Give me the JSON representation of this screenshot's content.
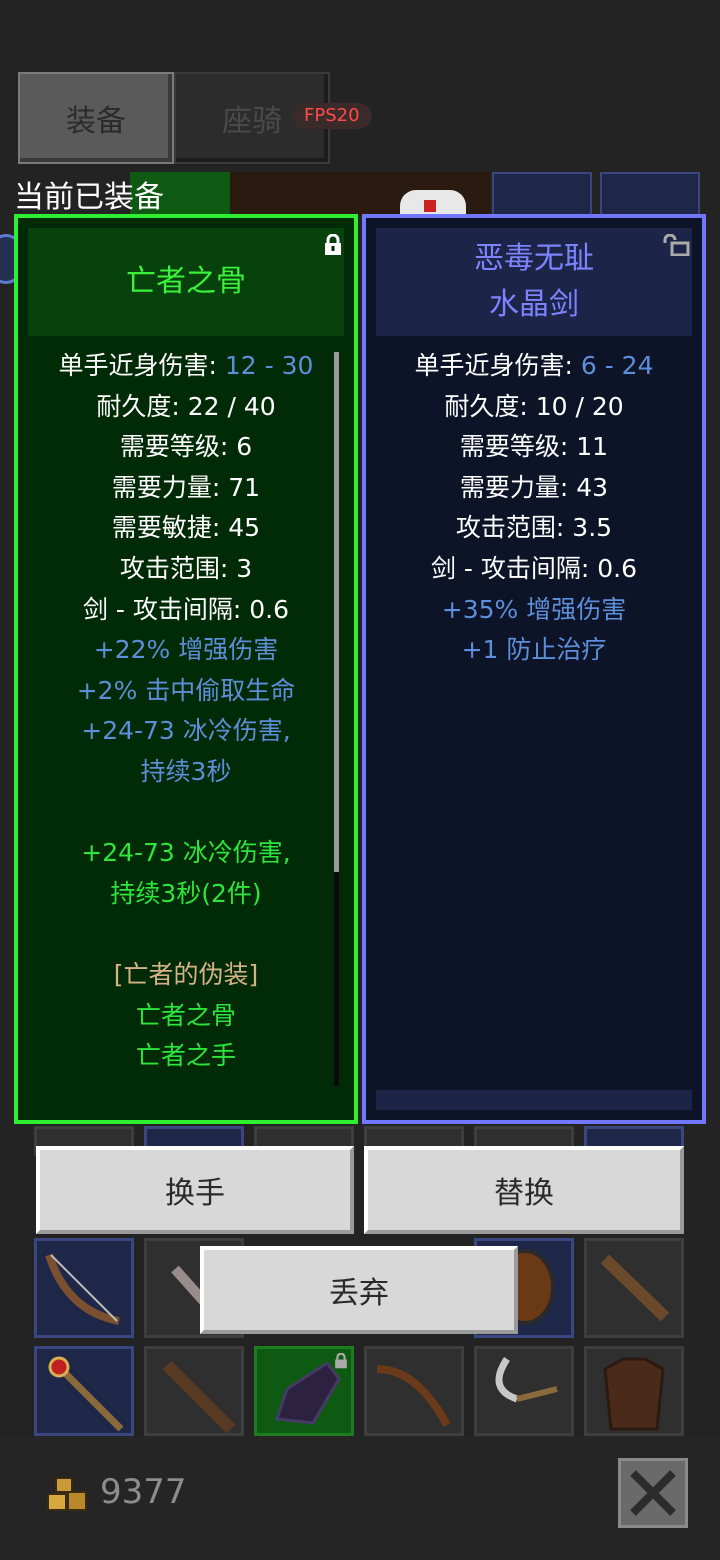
{
  "tabs": {
    "equipment": "装备",
    "mount": "座骑"
  },
  "fps_badge": "FPS20",
  "equipped_label": "当前已装备",
  "left_card": {
    "title": "亡者之骨",
    "stats": {
      "damage_label": "单手近身伤害: ",
      "damage_value": "12 - 30",
      "durability": "耐久度: 22 / 40",
      "req_level": "需要等级: 6",
      "req_str": "需要力量: 71",
      "req_dex": "需要敏捷: 45",
      "range": "攻击范围: 3",
      "interval": "剑 - 攻击间隔: 0.6"
    },
    "affixes": [
      "+22% 增强伤害",
      "+2% 击中偷取生命",
      "+24-73 冰冷伤害,",
      "持续3秒"
    ],
    "set_bonus": [
      "+24-73 冰冷伤害,",
      "持续3秒(2件)"
    ],
    "set_name": "[亡者的伪装]",
    "set_items": [
      "亡者之骨",
      "亡者之手"
    ],
    "colors": {
      "border": "#2ef030",
      "bg": "#012a06"
    }
  },
  "right_card": {
    "title_line1": "恶毒无耻",
    "title_line2": "水晶剑",
    "stats": {
      "damage_label": "单手近身伤害: ",
      "damage_value": "6 - 24",
      "durability": "耐久度: 10 / 20",
      "req_level": "需要等级: 11",
      "req_str": "需要力量: 43",
      "range": "攻击范围: 3.5",
      "interval": "剑 - 攻击间隔: 0.6"
    },
    "affixes": [
      "+35% 增强伤害",
      "+1 防止治疗"
    ],
    "colors": {
      "border": "#7177ff",
      "bg": "#0e1428"
    }
  },
  "buttons": {
    "swap_hand": "换手",
    "replace": "替换",
    "discard": "丢弃"
  },
  "gold": "9377"
}
